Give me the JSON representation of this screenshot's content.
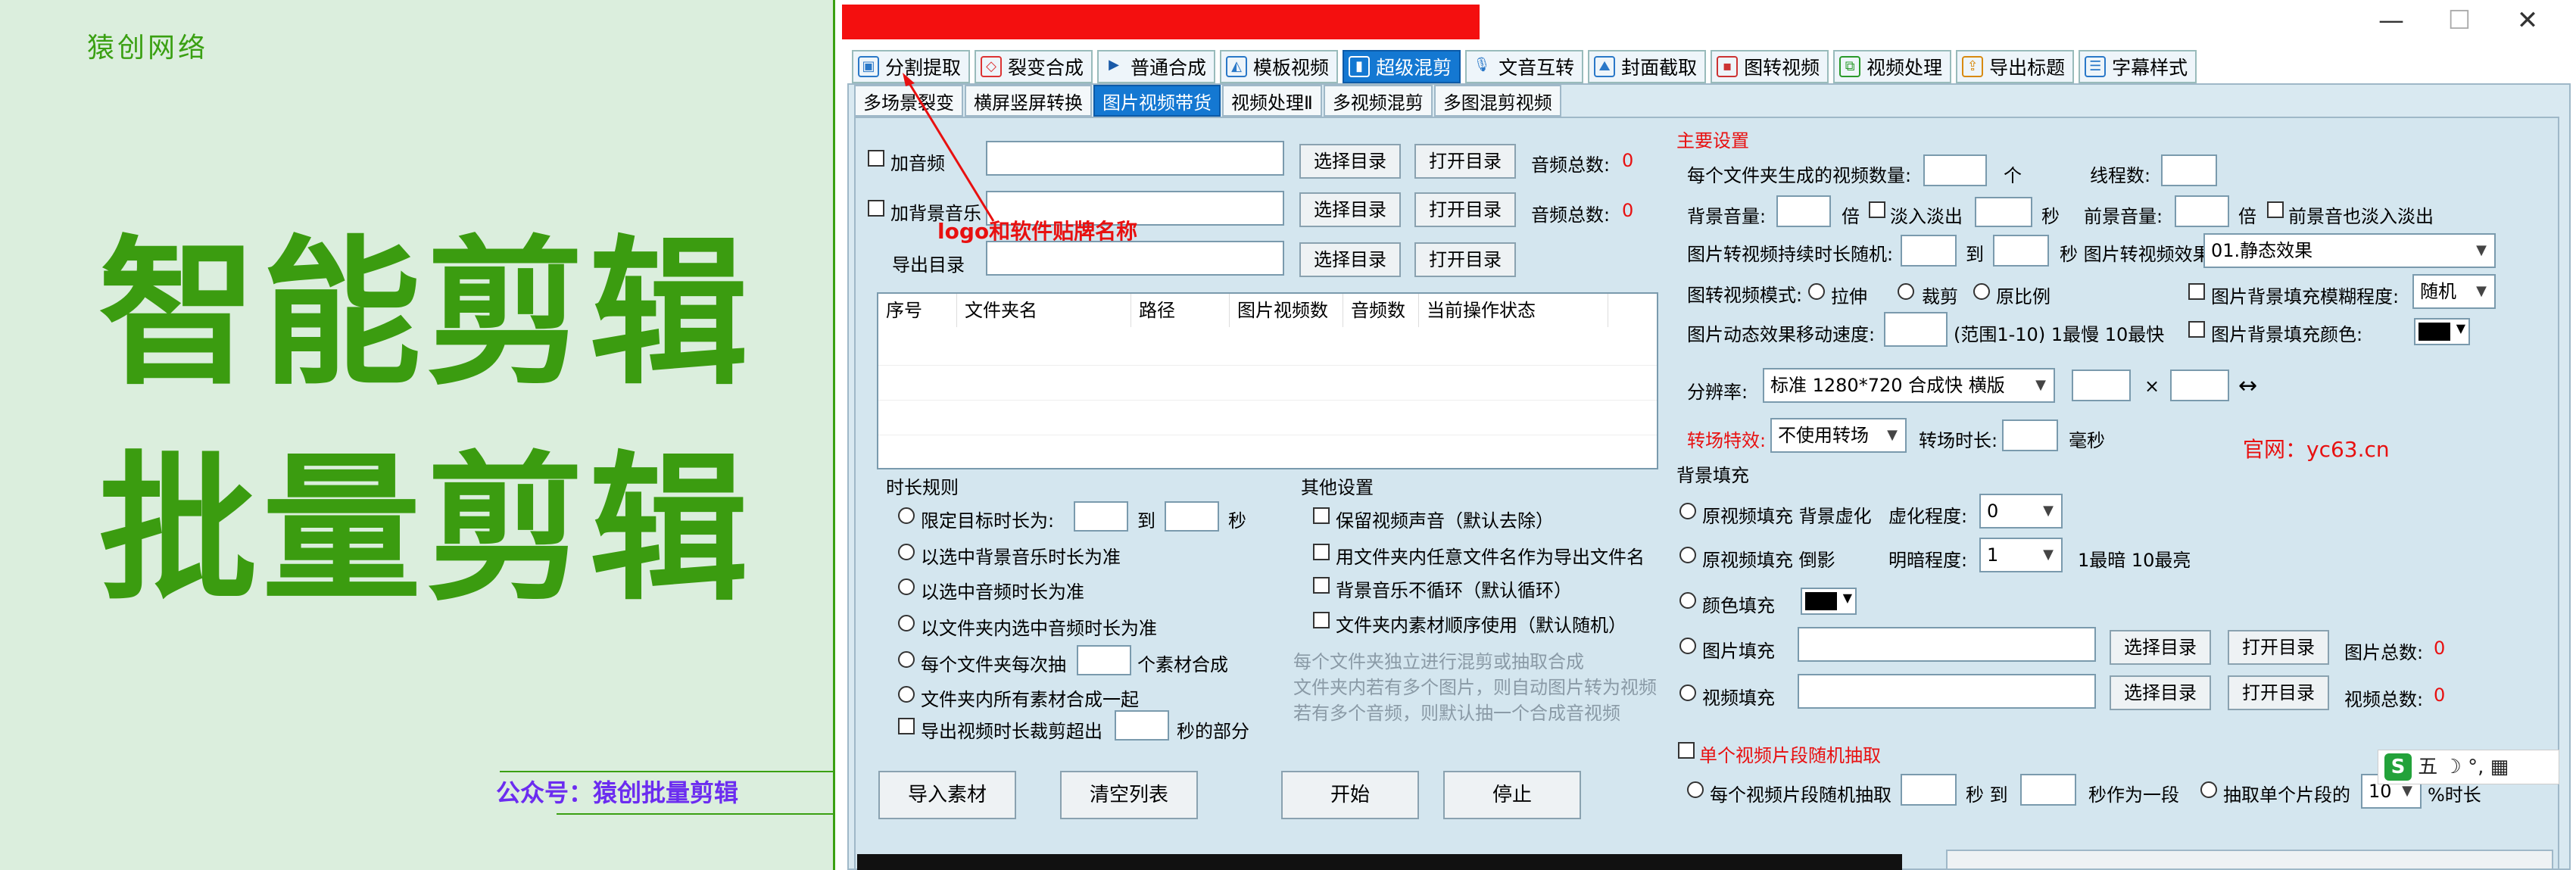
{
  "promo": {
    "brand": "猿创网络",
    "headline1": "智能剪辑",
    "headline2": "批量剪辑",
    "wechat": "公众号：猿创批量剪辑"
  },
  "window": {
    "min": "—",
    "max": "☐",
    "close": "✕"
  },
  "main_tabs": [
    {
      "label": "分割提取",
      "icon": "split-icon"
    },
    {
      "label": "裂变合成",
      "icon": "fission-icon"
    },
    {
      "label": "普通合成",
      "icon": "play-icon"
    },
    {
      "label": "模板视频",
      "icon": "template-icon"
    },
    {
      "label": "超级混剪",
      "icon": "chart-icon",
      "active": true
    },
    {
      "label": "文音互转",
      "icon": "mic-icon"
    },
    {
      "label": "封面截取",
      "icon": "image-icon"
    },
    {
      "label": "图转视频",
      "icon": "video-icon"
    },
    {
      "label": "视频处理",
      "icon": "process-icon"
    },
    {
      "label": "导出标题",
      "icon": "export-icon"
    },
    {
      "label": "字幕样式",
      "icon": "subtitle-icon"
    }
  ],
  "sub_tabs": [
    {
      "label": "多场景裂变"
    },
    {
      "label": "横屏竖屏转换"
    },
    {
      "label": "图片视频带货",
      "active": true
    },
    {
      "label": "视频处理Ⅱ"
    },
    {
      "label": "多视频混剪"
    },
    {
      "label": "多图混剪视频"
    }
  ],
  "left": {
    "add_audio": "加音频",
    "add_bgm": "加背景音乐",
    "export_dir": "导出目录",
    "choose_dir": "选择目录",
    "open_dir": "打开目录",
    "audio_total": "音频总数:",
    "audio_total_val": "0",
    "logo_note": "logo和软件贴牌名称",
    "table_headers": [
      "序号",
      "文件夹名",
      "路径",
      "图片视频数",
      "音频数",
      "当前操作状态"
    ],
    "duration_rules": "时长规则",
    "limit_target": "限定目标时长为:",
    "to": "到",
    "sec": "秒",
    "by_bgm": "以选中背景音乐时长为准",
    "by_audio": "以选中音频时长为准",
    "by_folder_audio": "以文件夹内选中音频时长为准",
    "each_folder": "每个文件夹每次抽",
    "material_merge": "个素材合成",
    "all_merge": "文件夹内所有素材合成一起",
    "trim_export": "导出视频时长裁剪超出",
    "sec_part": "秒的部分",
    "other_settings": "其他设置",
    "keep_sound": "保留视频声音（默认去除）",
    "use_name": "用文件夹内任意文件名作为导出文件名",
    "bgm_no_loop": "背景音乐不循环（默认循环）",
    "material_order": "文件夹内素材顺序使用（默认随机）",
    "hint1": "每个文件夹独立进行混剪或抽取合成",
    "hint2": "文件夹内若有多个图片，则自动图片转为视频",
    "hint3": "若有多个音频，则默认抽一个合成音视频",
    "import_btn": "导入素材",
    "clear_btn": "清空列表",
    "start_btn": "开始",
    "stop_btn": "停止"
  },
  "right": {
    "main_settings": "主要设置",
    "per_folder": "每个文件夹生成的视频数量:",
    "unit_ge": "个",
    "threads": "线程数:",
    "bgm_vol": "背景音量:",
    "times": "倍",
    "fade": "淡入淡出",
    "sec": "秒",
    "front_vol": "前景音量:",
    "front_fade": "前景音也淡入淡出",
    "img_dur": "图片转视频持续时长随机:",
    "to": "到",
    "img_effect": "秒 图片转视频效果:",
    "img_effect_val": "01.静态效果",
    "img_mode": "图转视频模式:",
    "stretch": "拉伸",
    "crop": "裁剪",
    "ratio": "原比例",
    "blur_fill": "图片背景填充模糊程度:",
    "blur_val": "随机",
    "move_speed": "图片动态效果移动速度:",
    "range": "(范围1-10)  1最慢 10最快",
    "color_fill_bg": "图片背景填充颜色:",
    "resolution": "分辨率:",
    "resolution_val": "标准 1280*720 合成快 横版",
    "x": "×",
    "swap": "↔",
    "transition": "转场特效:",
    "transition_val": "不使用转场",
    "trans_dur": "转场时长:",
    "ms": "毫秒",
    "website": "官网：yc63.cn",
    "bg_fill": "背景填充",
    "orig_blur": "原视频填充 背景虚化",
    "blur_degree": "虚化程度:",
    "blur_degree_val": "0",
    "orig_shadow": "原视频填充 倒影",
    "bright": "明暗程度:",
    "bright_val": "1",
    "bright_hint": "1最暗 10最亮",
    "color_fill": "颜色填充",
    "img_fill": "图片填充",
    "video_fill": "视频填充",
    "choose_dir": "选择目录",
    "open_dir": "打开目录",
    "img_total": "图片总数:",
    "video_total": "视频总数:",
    "total_val": "0",
    "single_random": "单个视频片段随机抽取",
    "each_segment": "每个视频片段随机抽取",
    "sec_to": "秒 到",
    "as_segment": "秒作为一段",
    "extract_single": "抽取单个片段的",
    "percent_val": "10",
    "percent_len": "%时长"
  },
  "ime": {
    "logo": "S",
    "text": "五 ☽ °, ▦"
  },
  "colors": {
    "green": "#3b9c10",
    "blue_tab": "#1478d2",
    "red": "#e81010",
    "purple": "#6b2cf0"
  }
}
